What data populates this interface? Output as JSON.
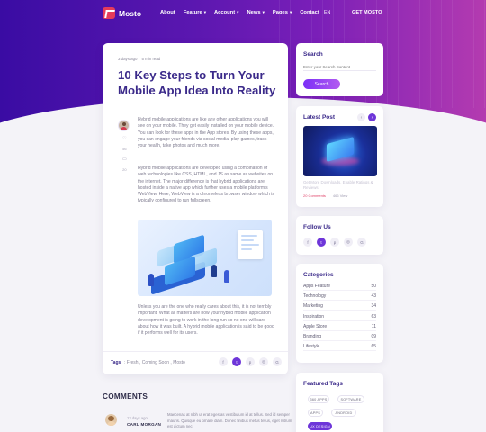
{
  "nav": {
    "logo_text": "Mosto",
    "items": [
      {
        "label": "About",
        "caret": false
      },
      {
        "label": "Feature",
        "caret": true
      },
      {
        "label": "Account",
        "caret": true
      },
      {
        "label": "News",
        "caret": true
      },
      {
        "label": "Pages",
        "caret": true
      },
      {
        "label": "Contact",
        "caret": false
      }
    ],
    "lang": "EN",
    "cta": "GET MOSTO"
  },
  "article": {
    "meta_date": "3 days ago",
    "meta_read": "5 min read",
    "title": "10 Key Steps to Turn Your Mobile App Idea Into Reality",
    "likes": "56",
    "comments": "20",
    "paragraph1": "Hybrid mobile applications are like any other applications you will see on your mobile. They get easily installed on your mobile device. You can look for these apps in the App stores. By using these apps, you can engage your friends via social media, play games, track your health, take photos and much more.",
    "paragraph2": "Hybrid mobile applications are developed using a combination of web technologies like CSS, HTML, and JS as same as websites on the internet. The major difference is that hybrid applications are hosted inside a native app which further uses a mobile platform's WebView. Here, WebView is a chromeless browser window which is typically configured to run fullscreen.",
    "paragraph3": "Unless you are the one who really cares about this, it is not terribly important. What all matters are how your hybrid mobile application development is going to work in the long run so no one will care about how it was built. A hybrid mobile application is said to be good if it performs well for its users.",
    "tags_label": "Tags",
    "tags_text": ": Fresh , Coming Soon , Mosto",
    "share_icons": [
      {
        "icon": "facebook-icon",
        "glyph": "f",
        "active": false
      },
      {
        "icon": "twitter-icon",
        "glyph": "t",
        "active": true
      },
      {
        "icon": "pinterest-icon",
        "glyph": "p",
        "active": false
      },
      {
        "icon": "dribbble-icon",
        "glyph": "◎",
        "active": false
      },
      {
        "icon": "google-icon",
        "glyph": "G",
        "active": false
      }
    ]
  },
  "comments": {
    "title": "COMMENTS",
    "items": [
      {
        "date": "13 days ago",
        "name": "CARL MORGAN",
        "text": "Maecenas at nibh ut erat egestas vestibulum id at tellus. Sed id semper mauris. Quisque eu ornare diam. Donec finibus metus tellus, eget rutrum est dictum nec."
      }
    ]
  },
  "sidebar": {
    "search": {
      "title": "Search",
      "placeholder": "Enter your Search Content",
      "button": "Search"
    },
    "latest": {
      "title": "Latest Post",
      "caption": "Get More Downloads. Enable Ratings & Reviews",
      "comments": "20 Comments",
      "views": "466 View"
    },
    "follow": {
      "title": "Follow Us",
      "icons": [
        {
          "icon": "facebook-icon",
          "glyph": "f",
          "active": false
        },
        {
          "icon": "twitter-icon",
          "glyph": "t",
          "active": true
        },
        {
          "icon": "pinterest-icon",
          "glyph": "p",
          "active": false
        },
        {
          "icon": "dribbble-icon",
          "glyph": "◎",
          "active": false
        },
        {
          "icon": "google-icon",
          "glyph": "G",
          "active": false
        }
      ]
    },
    "categories": {
      "title": "Categories",
      "items": [
        {
          "name": "Apps Feature",
          "count": "50"
        },
        {
          "name": "Technology",
          "count": "43"
        },
        {
          "name": "Marketing",
          "count": "34"
        },
        {
          "name": "Inspiration",
          "count": "63"
        },
        {
          "name": "Apple Store",
          "count": "11"
        },
        {
          "name": "Branding",
          "count": "09"
        },
        {
          "name": "Lifestyle",
          "count": "65"
        }
      ]
    },
    "tags": {
      "title": "Featured Tags",
      "items": [
        {
          "label": "360 APPS",
          "active": false
        },
        {
          "label": "SOFTWARE",
          "active": false
        },
        {
          "label": "APPS",
          "active": false
        },
        {
          "label": "ANDROID",
          "active": false
        },
        {
          "label": "UX DESIGN",
          "active": true
        }
      ]
    }
  },
  "colors": {
    "accent": "#6e36d9",
    "brand": "#e53b5a",
    "title": "#3b2a8a"
  }
}
